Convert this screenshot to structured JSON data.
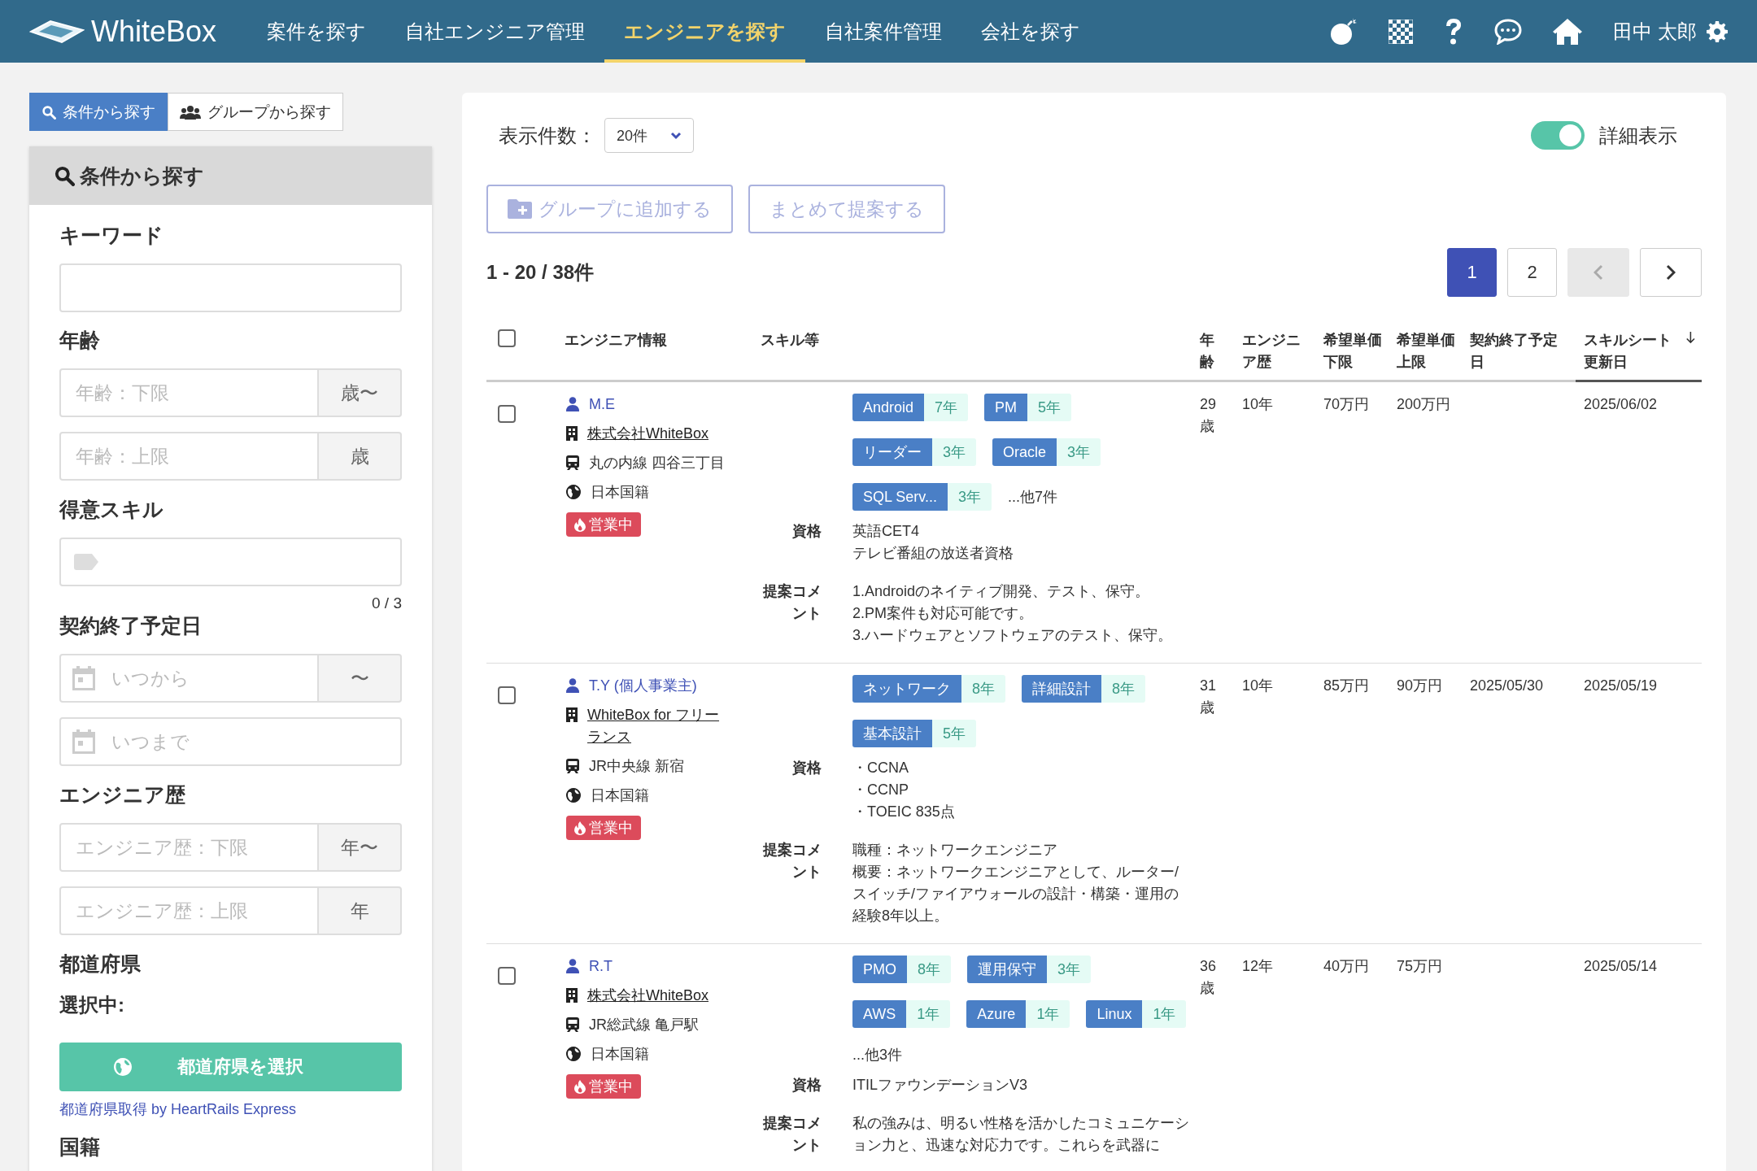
{
  "header": {
    "logo": "WhiteBox",
    "nav": [
      {
        "label": "案件を探す",
        "selected": false
      },
      {
        "label": "自社エンジニア管理",
        "selected": false
      },
      {
        "label": "エンジニアを探す",
        "selected": true
      },
      {
        "label": "自社案件管理",
        "selected": false
      },
      {
        "label": "会社を探す",
        "selected": false
      }
    ],
    "user_name": "田中 太郎"
  },
  "search_tabs": [
    {
      "label": "条件から探す",
      "kind": "conditions",
      "selected": true
    },
    {
      "label": "グループから探す",
      "kind": "groups",
      "selected": false
    }
  ],
  "sidebar": {
    "title": "条件から探す",
    "sections": [
      {
        "kind": "text",
        "label": "キーワード"
      },
      {
        "kind": "range",
        "label": "年齢",
        "inputs": [
          {
            "placeholder": "年齢：下限",
            "addon": "歳〜"
          },
          {
            "placeholder": "年齢：上限",
            "addon": "歳"
          }
        ]
      },
      {
        "kind": "tags",
        "label": "得意スキル",
        "counter": "0 / 3"
      },
      {
        "kind": "date",
        "label": "契約終了予定日",
        "inputs": [
          {
            "placeholder": "いつから",
            "addon": "〜"
          },
          {
            "placeholder": "いつまで"
          }
        ]
      },
      {
        "kind": "range",
        "label": "エンジニア歴",
        "inputs": [
          {
            "placeholder": "エンジニア歴：下限",
            "addon": "年〜"
          },
          {
            "placeholder": "エンジニア歴：上限",
            "addon": "年"
          }
        ]
      },
      {
        "kind": "prefecture",
        "label": "都道府県",
        "selected_label": "選択中:",
        "button": "都道府県を選択",
        "credit": "都道府県取得 by HeartRails Express"
      },
      {
        "kind": "heading",
        "label": "国籍"
      }
    ]
  },
  "main": {
    "page_size": {
      "label": "表示件数：",
      "value": "20件"
    },
    "detail_toggle": {
      "label": "詳細表示",
      "on": true
    },
    "actions": [
      {
        "label": "グループに追加する",
        "kind": "group",
        "disabled": true
      },
      {
        "label": "まとめて提案する",
        "kind": "plain",
        "disabled": true
      }
    ],
    "result_count": "1 - 20 / 38件",
    "pagination": {
      "pages": [
        {
          "label": "1",
          "selected": true
        },
        {
          "label": "2",
          "selected": false
        }
      ],
      "prev_disabled": true,
      "next_disabled": false
    },
    "table": {
      "select_all": {
        "checked": false
      },
      "columns": [
        {
          "label": "エンジニア情報",
          "sorted": false
        },
        {
          "label": "スキル等",
          "sorted": false
        },
        {
          "label": "年齢",
          "sorted": false
        },
        {
          "label": "エンジニア歴",
          "sorted": false
        },
        {
          "label": "希望単価下限",
          "sorted": false
        },
        {
          "label": "希望単価上限",
          "sorted": false
        },
        {
          "label": "契約終了予定日",
          "sorted": false
        },
        {
          "label": "スキルシート更新日",
          "sorted": true
        }
      ],
      "rows": [
        {
          "checked": false,
          "name": "M.E",
          "company": "株式会社WhiteBox",
          "station": "丸の内線 四谷三丁目",
          "nationality": "日本国籍",
          "status": "営業中",
          "skills": [
            {
              "name": "Android",
              "years": "7年"
            },
            {
              "name": "PM",
              "years": "5年"
            },
            {
              "name": "リーダー",
              "years": "3年"
            },
            {
              "name": "Oracle",
              "years": "3年"
            },
            {
              "name": "SQL Serv...",
              "years": "3年"
            }
          ],
          "more": "...他7件",
          "qual_label": "資格",
          "qualifications": [
            "英語CET4",
            "テレビ番組の放送者資格"
          ],
          "comment_label": "提案コメント",
          "comment": [
            "1.Androidのネイティブ開発、テスト、保守。",
            "2.PM案件も対応可能です。",
            "3.ハードウェアとソフトウェアのテスト、保守。"
          ],
          "age": "29歳",
          "experience": "10年",
          "rate_min": "70万円",
          "rate_max": "200万円",
          "contract_end": "",
          "sheet_updated": "2025/06/02"
        },
        {
          "checked": false,
          "name": "T.Y (個人事業主)",
          "company": "WhiteBox for フリーランス",
          "station": "JR中央線 新宿",
          "nationality": "日本国籍",
          "status": "営業中",
          "skills": [
            {
              "name": "ネットワーク",
              "years": "8年"
            },
            {
              "name": "詳細設計",
              "years": "8年"
            },
            {
              "name": "基本設計",
              "years": "5年"
            }
          ],
          "more": "",
          "qual_label": "資格",
          "qualifications": [
            "・CCNA",
            "・CCNP",
            "・TOEIC 835点"
          ],
          "comment_label": "提案コメント",
          "comment": [
            "職種：ネットワークエンジニア",
            "概要：ネットワークエンジニアとして、ルーター/スイッチ/ファイアウォールの設計・構築・運用の経験8年以上。"
          ],
          "age": "31歳",
          "experience": "10年",
          "rate_min": "85万円",
          "rate_max": "90万円",
          "contract_end": "2025/05/30",
          "sheet_updated": "2025/05/19"
        },
        {
          "checked": false,
          "name": "R.T",
          "company": "株式会社WhiteBox",
          "station": "JR総武線 亀戸駅",
          "nationality": "日本国籍",
          "status": "営業中",
          "skills": [
            {
              "name": "PMO",
              "years": "8年"
            },
            {
              "name": "運用保守",
              "years": "3年"
            },
            {
              "name": "AWS",
              "years": "1年"
            },
            {
              "name": "Azure",
              "years": "1年"
            },
            {
              "name": "Linux",
              "years": "1年"
            }
          ],
          "more": "...他3件",
          "qual_label": "資格",
          "qualifications": [
            "ITILファウンデーションV3"
          ],
          "comment_label": "提案コメント",
          "comment": [
            "私の強みは、明るい性格を活かしたコミュニケーション力と、迅速な対応力です。これらを武器に"
          ],
          "age": "36歳",
          "experience": "12年",
          "rate_min": "40万円",
          "rate_max": "75万円",
          "contract_end": "",
          "sheet_updated": "2025/05/14"
        }
      ]
    }
  }
}
